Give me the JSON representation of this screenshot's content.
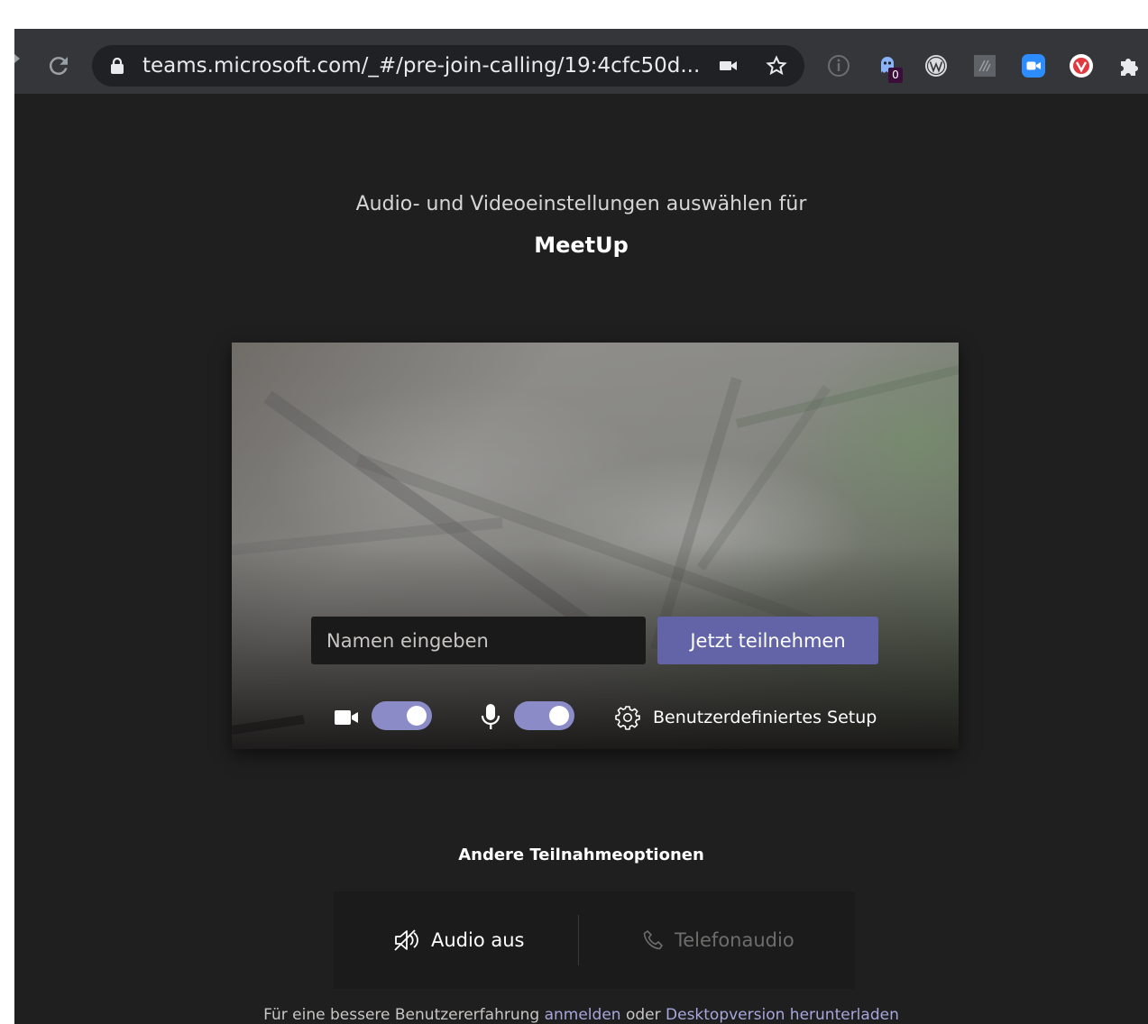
{
  "browser": {
    "url": "teams.microsoft.com/_#/pre-join-calling/19:4cfc50d...",
    "extension_badge": "0"
  },
  "prejoin": {
    "subtitle": "Audio- und Videoeinstellungen auswählen für",
    "meeting_title": "MeetUp",
    "name_placeholder": "Namen eingeben",
    "name_value": "",
    "join_label": "Jetzt teilnehmen",
    "camera_on": true,
    "mic_on": true,
    "setup_label": "Benutzerdefiniertes Setup"
  },
  "other_options": {
    "heading": "Andere Teilnahmeoptionen",
    "audio_off_label": "Audio aus",
    "phone_audio_label": "Telefonaudio"
  },
  "footer": {
    "prefix": "Für eine bessere Benutzererfahrung ",
    "signin_link": "anmelden",
    "middle": " oder ",
    "download_link": "Desktopversion herunterladen"
  },
  "colors": {
    "accent": "#6264a7",
    "toggle_on": "#8b8cc7",
    "background": "#1f1f1f",
    "link": "#a6a7dc"
  }
}
